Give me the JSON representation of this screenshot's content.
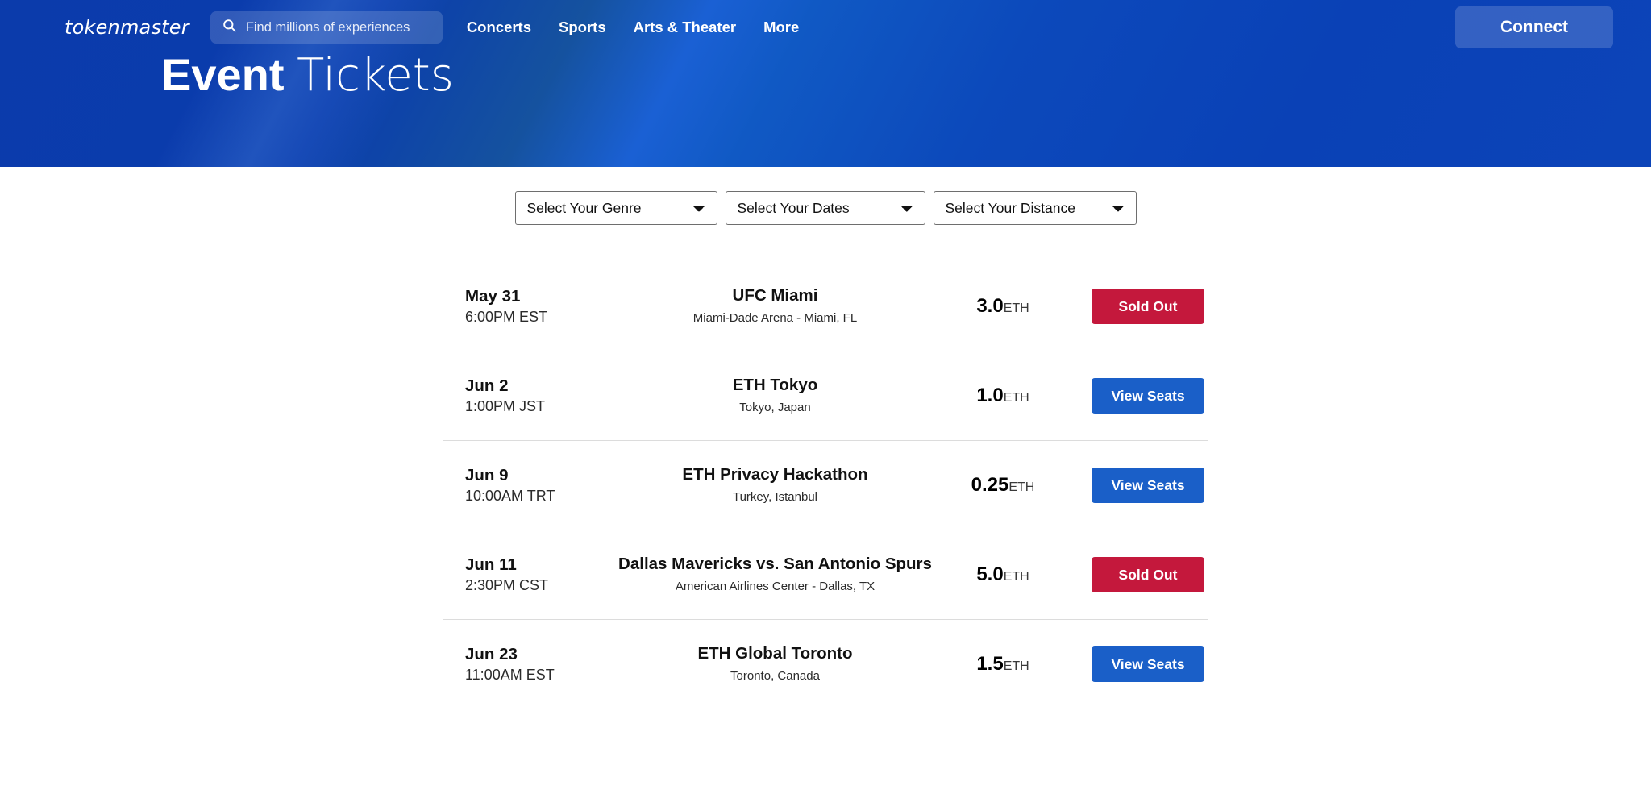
{
  "header": {
    "logo": "tokenmaster",
    "search": {
      "icon": "search-icon",
      "placeholder": "Find millions of experiences",
      "value": ""
    },
    "nav_links": [
      {
        "label": "Concerts"
      },
      {
        "label": "Sports"
      },
      {
        "label": "Arts & Theater"
      },
      {
        "label": "More"
      }
    ],
    "connect_label": "Connect"
  },
  "hero": {
    "title_bold": "Event",
    "title_light": "Tickets"
  },
  "filters": [
    {
      "name": "genre",
      "selected": "Select Your Genre"
    },
    {
      "name": "dates",
      "selected": "Select Your Dates"
    },
    {
      "name": "distance",
      "selected": "Select Your Distance"
    }
  ],
  "events": [
    {
      "date": "May 31",
      "time": "6:00PM EST",
      "name": "UFC Miami",
      "venue": "Miami-Dade Arena - Miami, FL",
      "price": "3.0",
      "currency": "ETH",
      "action_label": "Sold Out",
      "action_state": "sold-out"
    },
    {
      "date": "Jun 2",
      "time": "1:00PM JST",
      "name": "ETH Tokyo",
      "venue": "Tokyo, Japan",
      "price": "1.0",
      "currency": "ETH",
      "action_label": "View Seats",
      "action_state": "available"
    },
    {
      "date": "Jun 9",
      "time": "10:00AM TRT",
      "name": "ETH Privacy Hackathon",
      "venue": "Turkey, Istanbul",
      "price": "0.25",
      "currency": "ETH",
      "action_label": "View Seats",
      "action_state": "available"
    },
    {
      "date": "Jun 11",
      "time": "2:30PM CST",
      "name": "Dallas Mavericks vs. San Antonio Spurs",
      "venue": "American Airlines Center - Dallas, TX",
      "price": "5.0",
      "currency": "ETH",
      "action_label": "Sold Out",
      "action_state": "sold-out"
    },
    {
      "date": "Jun 23",
      "time": "11:00AM EST",
      "name": "ETH Global Toronto",
      "venue": "Toronto, Canada",
      "price": "1.5",
      "currency": "ETH",
      "action_label": "View Seats",
      "action_state": "available"
    }
  ],
  "colors": {
    "hero_blue_dark": "#0b3bab",
    "hero_blue_light": "#1a60d4",
    "sold_out_red": "#c4183c",
    "view_seats_blue": "#1a5fc8"
  }
}
